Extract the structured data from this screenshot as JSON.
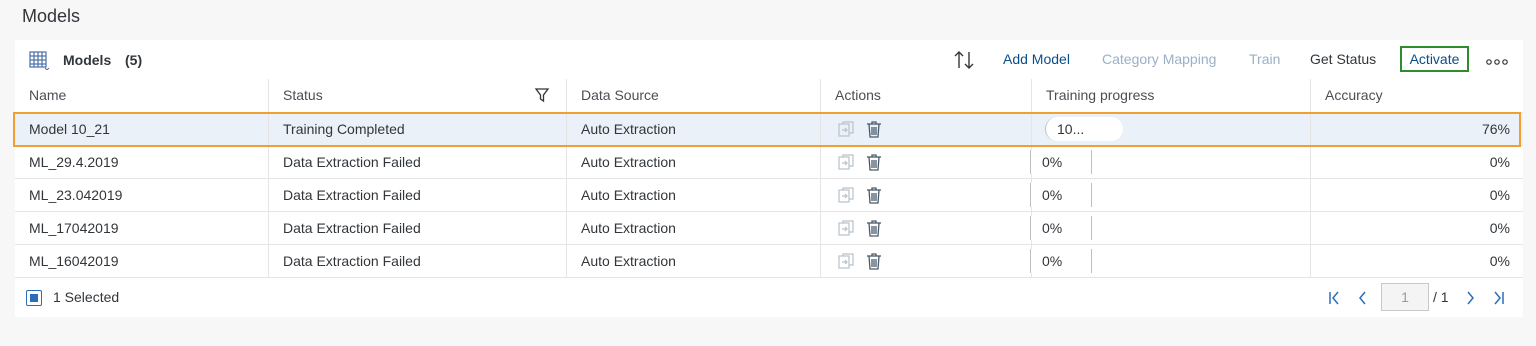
{
  "page": {
    "title": "Models"
  },
  "toolbar": {
    "title": "Models",
    "count": "(5)",
    "icons": {
      "table": "table-icon",
      "sort": "sort-icon",
      "more": "more-icon"
    },
    "buttons": {
      "add_model": "Add Model",
      "category_mapping": "Category Mapping",
      "train": "Train",
      "get_status": "Get Status",
      "activate": "Activate"
    }
  },
  "table": {
    "columns": [
      "Name",
      "Status",
      "Data Source",
      "Actions",
      "Training progress",
      "Accuracy"
    ],
    "rows": [
      {
        "name": "Model 10_21",
        "status": "Training Completed",
        "source": "Auto Extraction",
        "progress": "10...",
        "accuracy": "76%",
        "selected": true
      },
      {
        "name": "ML_29.4.2019",
        "status": "Data Extraction Failed",
        "source": "Auto Extraction",
        "progress": "0%",
        "accuracy": "0%"
      },
      {
        "name": "ML_23.042019",
        "status": "Data Extraction Failed",
        "source": "Auto Extraction",
        "progress": "0%",
        "accuracy": "0%"
      },
      {
        "name": "ML_17042019",
        "status": "Data Extraction Failed",
        "source": "Auto Extraction",
        "progress": "0%",
        "accuracy": "0%"
      },
      {
        "name": "ML_16042019",
        "status": "Data Extraction Failed",
        "source": "Auto Extraction",
        "progress": "0%",
        "accuracy": "0%"
      }
    ]
  },
  "footer": {
    "selected_text": "1 Selected",
    "page_value": "1",
    "page_of": "/ 1"
  },
  "colors": {
    "accent": "#0a4e8a",
    "highlight": "#f0a030",
    "activate_border": "#2e8b2e",
    "selected_row": "#eaf1f8"
  }
}
